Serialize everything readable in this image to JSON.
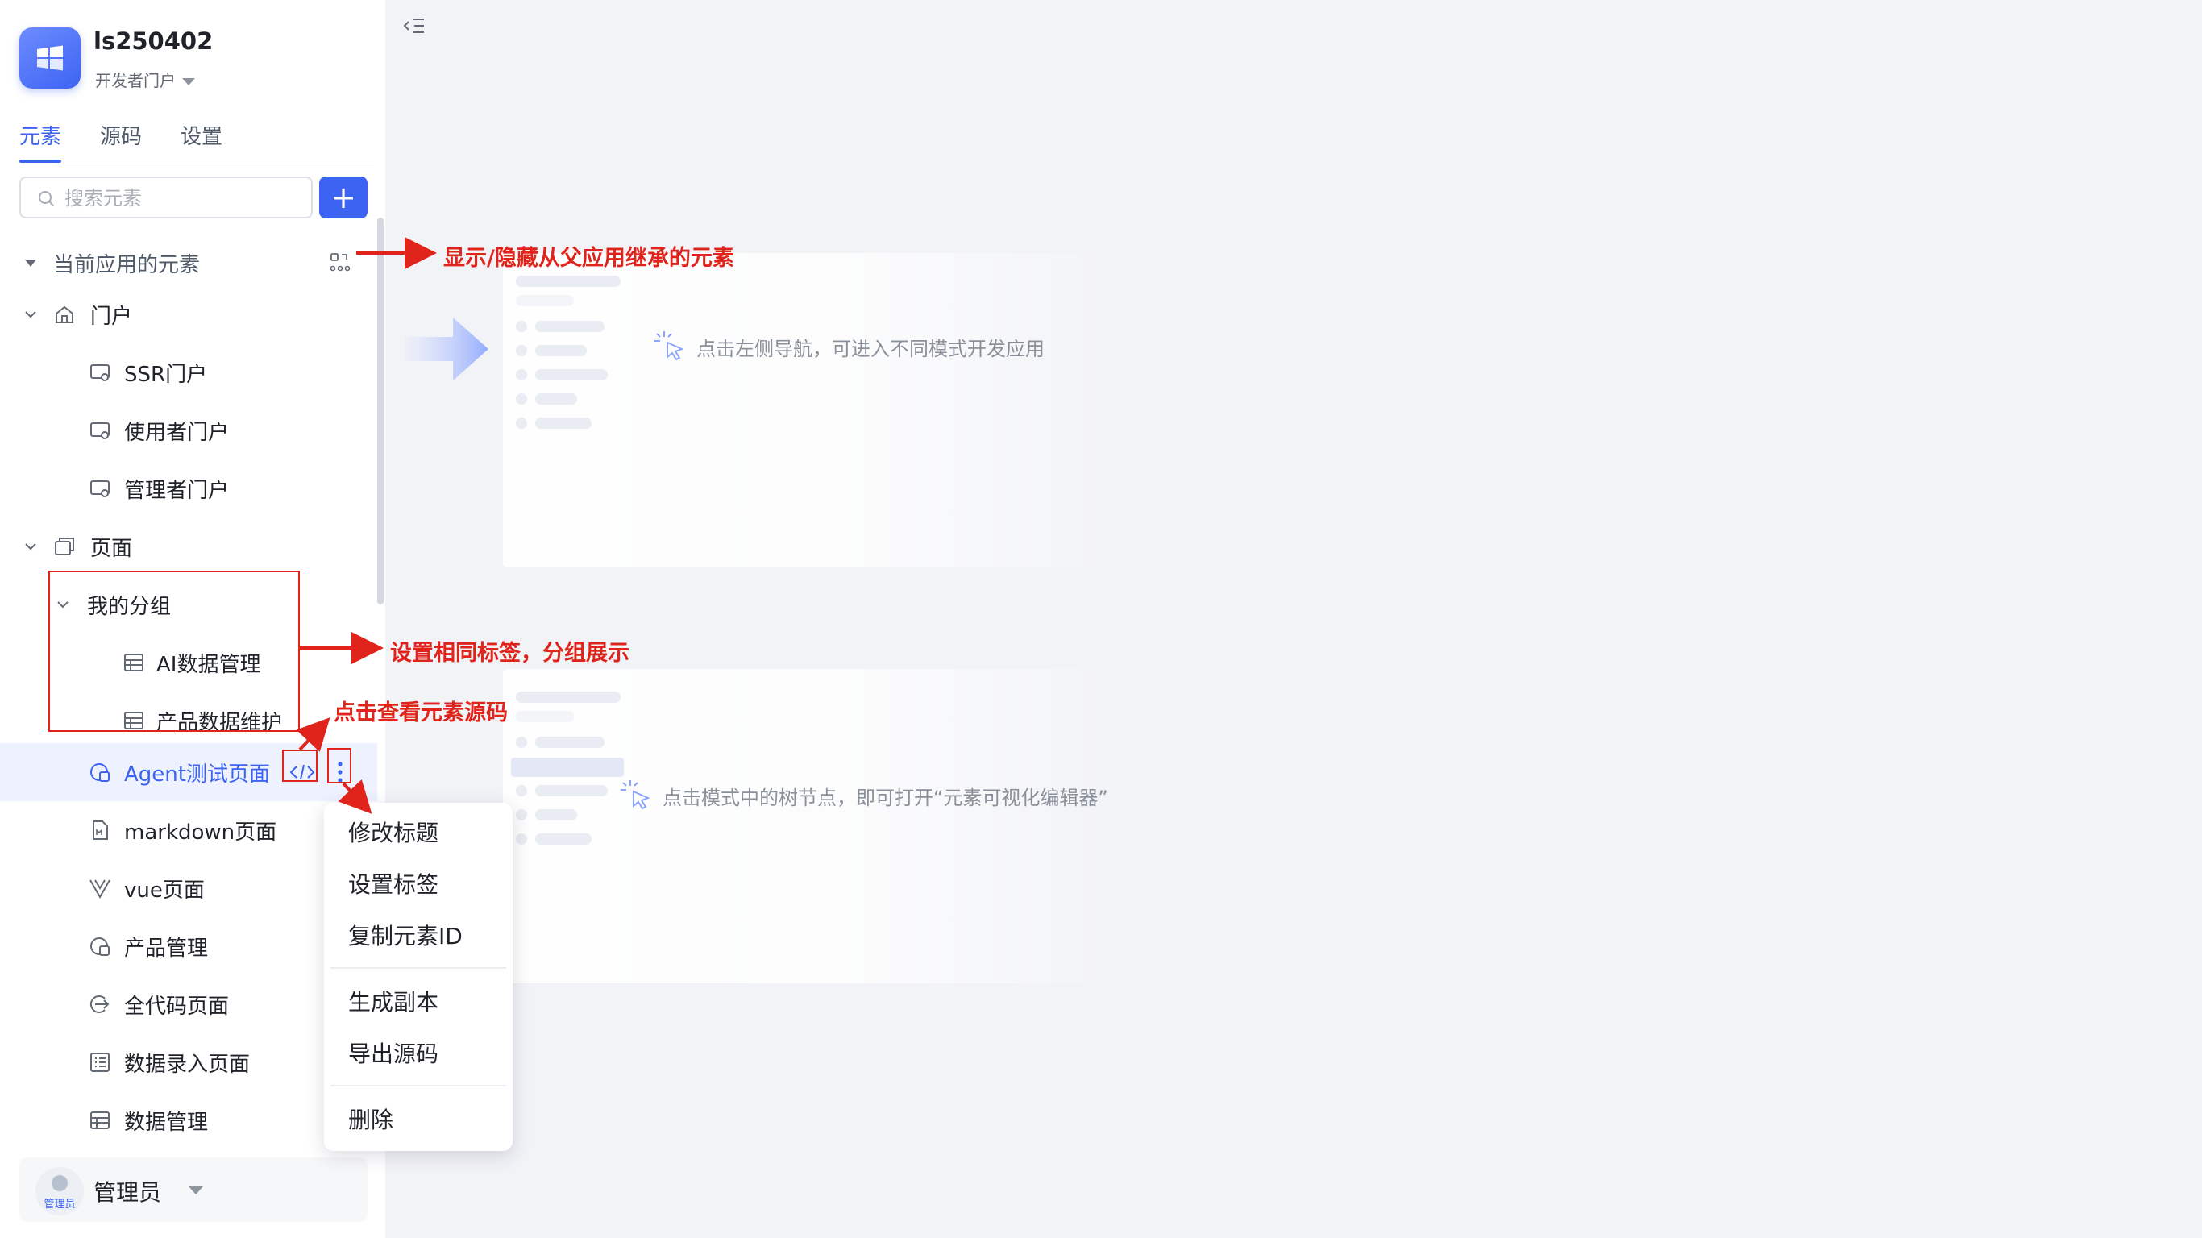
{
  "app": {
    "name": "ls250402",
    "portal_label": "开发者门户"
  },
  "tabs": [
    {
      "label": "元素",
      "active": true
    },
    {
      "label": "源码",
      "active": false
    },
    {
      "label": "设置",
      "active": false
    }
  ],
  "search": {
    "placeholder": "搜索元素"
  },
  "add_button": {
    "label": "+"
  },
  "tree": {
    "section_title": "当前应用的元素",
    "portal_group": {
      "label": "门户",
      "items": [
        "SSR门户",
        "使用者门户",
        "管理者门户"
      ]
    },
    "page_group": {
      "label": "页面",
      "subgroup": {
        "label": "我的分组",
        "items": [
          "AI数据管理",
          "产品数据维护"
        ]
      },
      "items": [
        "Agent测试页面",
        "markdown页面",
        "vue页面",
        "产品管理",
        "全代码页面",
        "数据录入页面",
        "数据管理"
      ],
      "selected": "Agent测试页面"
    }
  },
  "context_menu": {
    "items": [
      "修改标题",
      "设置标签",
      "复制元素ID",
      "生成副本",
      "导出源码",
      "删除"
    ]
  },
  "footer": {
    "user": "管理员",
    "avatar_badge": "管理员"
  },
  "main": {
    "hint_1": "点击左侧导航，可进入不同模式开发应用",
    "hint_2": "点击模式中的树节点，即可打开“元素可视化编辑器”"
  },
  "annotations": {
    "inherit_toggle": "显示/隐藏从父应用继承的元素",
    "group_tag": "设置相同标签，分组展示",
    "view_source": "点击查看元素源码"
  },
  "colors": {
    "accent": "#3d63f2",
    "annotation": "#e0241c",
    "background": "#f2f3f7",
    "selected_row": "#eef2ff"
  }
}
